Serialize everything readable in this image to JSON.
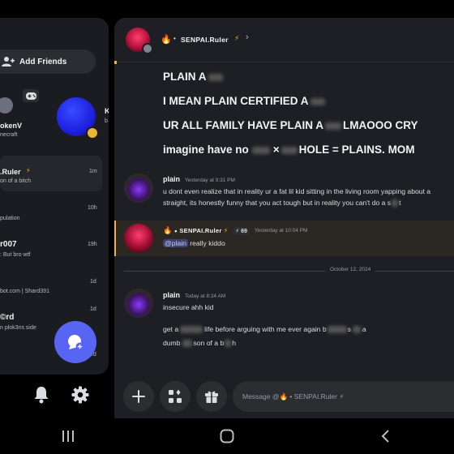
{
  "sidebar": {
    "add_friends_label": "Add Friends",
    "friend_card_1": {
      "name": "okenV",
      "activity": "necraft"
    },
    "friend_card_2": {
      "initial": "K",
      "sub": "b"
    },
    "dms": [
      {
        "name": ".Ruler",
        "sub": "on of a bitch",
        "time": "1m"
      },
      {
        "name": "",
        "sub": "pulation",
        "time": "10h"
      },
      {
        "name": "r007",
        "sub": ": But bro wtf",
        "time": "19h"
      },
      {
        "name": "",
        "sub": "bot.com | Shard391",
        "time": "1d"
      },
      {
        "name": "©rd",
        "sub": "n plok3ns side",
        "time": "1d"
      }
    ],
    "partial_time": "2d"
  },
  "channel": {
    "name": "SENPAI.Ruler",
    "prefix_emoji": "🔥",
    "suffix_emoji": "⚡"
  },
  "messages_top": [
    {
      "text": "PLAIN A"
    },
    {
      "text": "I MEAN PLAIN CERTIFIED A"
    },
    {
      "text_a": "UR ALL FAMILY HAVE PLAIN A",
      "text_b": "LMAOOO CRY"
    },
    {
      "text_a": "imagine have no",
      "text_b": "×",
      "text_c": "HOLE = PLAINS. MOM"
    }
  ],
  "message_plain_1": {
    "author": "plain",
    "timestamp": "Yesterday at 9:31 PM",
    "line1": "u dont even realize that in reality ur a fat lil kid sitting in the living room yapping about a",
    "line2_a": "straight, its honestly funny that you act tough but in reality you can't do a s",
    "line2_b": "t"
  },
  "message_senpai": {
    "author": "SENPAI.Ruler",
    "badge_count": "69",
    "timestamp": "Yesterday at 10:04 PM",
    "mention": "@plain",
    "text": " really kiddo"
  },
  "date_divider": "October 12, 2024",
  "message_plain_2": {
    "author": "plain",
    "timestamp": "Today at 8:24 AM",
    "line1": "insecure ahh kid",
    "line2_a": "get a",
    "line2_b": "life before arguing with me ever again b",
    "line2_c": "s",
    "line2_d": "a",
    "line3_a": "dumb",
    "line3_b": "son of a b",
    "line3_c": "h"
  },
  "composer": {
    "placeholder": "Message @🔥 • SENPAI.Ruler ⚡"
  },
  "colors": {
    "accent": "#5865f2",
    "panel": "#1e1f24",
    "sidebar": "#1b1c21",
    "mention_bar": "#f0b232"
  }
}
